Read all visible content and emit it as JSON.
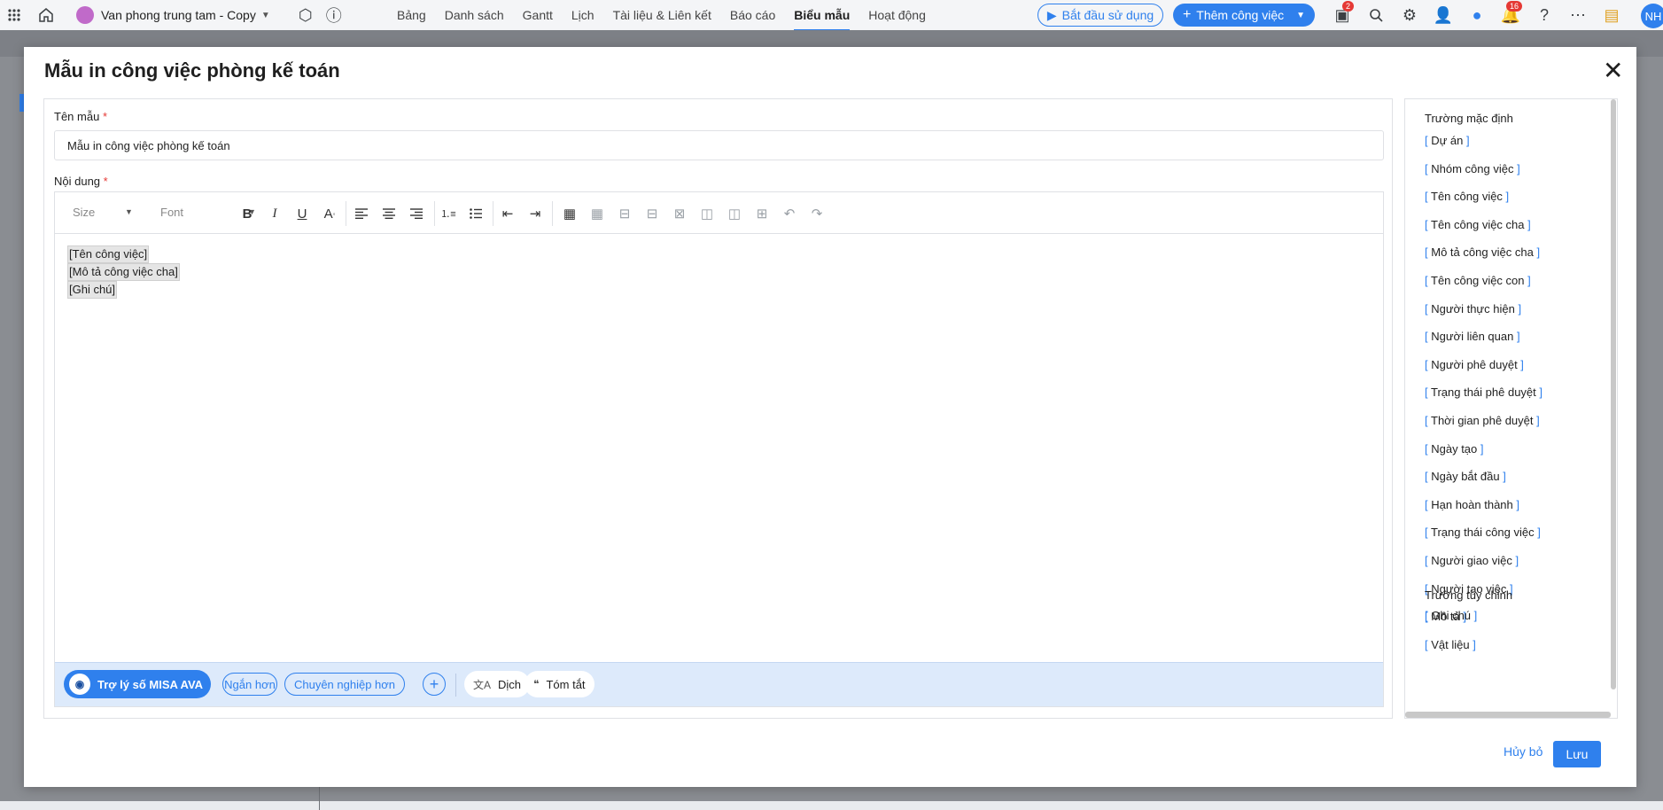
{
  "topbar": {
    "project_name": "Van phong trung tam - Copy",
    "nav": [
      "Bảng",
      "Danh sách",
      "Gantt",
      "Lịch",
      "Tài liệu & Liên kết",
      "Báo cáo",
      "Biểu mẫu",
      "Hoạt động"
    ],
    "active_nav": "Biểu mẫu",
    "start_label": "Bắt đầu sử dụng",
    "add_task_label": "Thêm công việc",
    "cart_badge": "2",
    "notification_badge": "16",
    "avatar_initials": "NH"
  },
  "modal": {
    "title": "Mẫu in công việc phòng kế toán",
    "name_label": "Tên mẫu",
    "name_value": "Mẫu in công việc phòng kế toán",
    "content_label": "Nội dung",
    "required_mark": "*",
    "toolbar": {
      "size_placeholder": "Size",
      "font_placeholder": "Font"
    },
    "content_lines": [
      "[Tên công việc]",
      "[Mô tả công việc cha]",
      "[Ghi chú]"
    ],
    "ai": {
      "assistant_label": "Trợ lý số MISA AVA",
      "shorter_label": "Ngắn hơn",
      "professional_label": "Chuyên nghiệp hơn",
      "translate_label": "Dịch",
      "summary_label": "Tóm tắt"
    },
    "default_fields_title": "Trường mặc định",
    "default_fields": [
      "Dự án",
      "Nhóm công việc",
      "Tên công việc",
      "Tên công việc cha",
      "Mô tả công việc cha",
      "Tên công việc con",
      "Người thực hiện",
      "Người liên quan",
      "Người phê duyệt",
      "Trạng thái phê duyệt",
      "Thời gian phê duyệt",
      "Ngày tạo",
      "Ngày bắt đầu",
      "Hạn hoàn thành",
      "Trạng thái công việc",
      "Người giao việc",
      "Người tạo việc",
      "Mô tả",
      "Vật liệu"
    ],
    "custom_fields_title": "Trường tùy chỉnh",
    "custom_fields": [
      "Ghi chú"
    ],
    "cancel_label": "Hủy bỏ",
    "save_label": "Lưu"
  },
  "colors": {
    "accent": "#2f80ed",
    "required": "#e53935"
  }
}
